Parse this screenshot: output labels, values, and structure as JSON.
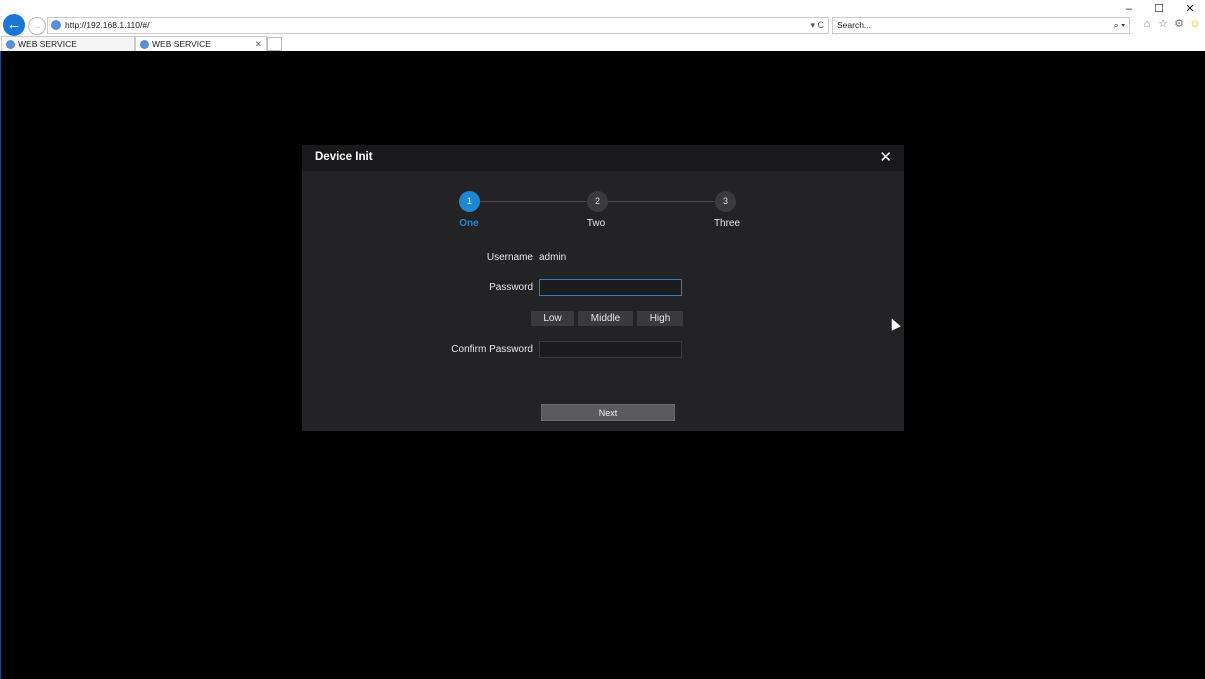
{
  "browser": {
    "window_controls": [
      "–",
      "☐",
      "✕"
    ],
    "address": "http://192.168.1.110/#/",
    "address_controls": "▾ C",
    "search_placeholder": "Search...",
    "search_controls": "⌕ ▾",
    "tabs": [
      {
        "label": "WEB SERVICE"
      },
      {
        "label": "WEB SERVICE",
        "close": "✕"
      }
    ],
    "tool_icons": [
      "home-icon",
      "star-icon",
      "gear-icon",
      "smiley-icon"
    ]
  },
  "dialog": {
    "title": "Device Init",
    "close": "✕",
    "steps": [
      {
        "number": "1",
        "label": "One",
        "active": true
      },
      {
        "number": "2",
        "label": "Two",
        "active": false
      },
      {
        "number": "3",
        "label": "Three",
        "active": false
      }
    ],
    "form": {
      "username_label": "Username",
      "username_value": "admin",
      "password_label": "Password",
      "password_value": "",
      "strength": [
        "Low",
        "Middle",
        "High"
      ],
      "confirm_label": "Confirm Password",
      "confirm_value": ""
    },
    "next_label": "Next"
  },
  "colors": {
    "accent": "#1f86d1",
    "dialog_bg": "#232326",
    "header_bg": "#19191b"
  }
}
